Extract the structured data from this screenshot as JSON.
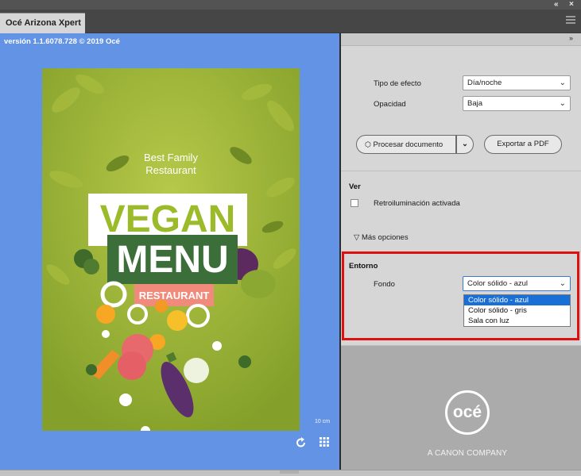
{
  "window": {
    "title_tab": "Océ Arizona Xpert",
    "top_controls": [
      "«",
      "×"
    ],
    "right_collapse": "»"
  },
  "preview": {
    "version_text": "versión 1.1.6078.728 © 2019 Océ",
    "poster_text": {
      "line1": "Best Family",
      "line2": "Restaurant",
      "vegan": "VEGAN",
      "menu": "MENU",
      "restaurant": "RESTAURANT"
    },
    "scale_label": "10 cm"
  },
  "settings": {
    "tipo_label": "Tipo de efecto",
    "tipo_value": "Día/noche",
    "opacidad_label": "Opacidad",
    "opacidad_value": "Baja",
    "procesar_label": "Procesar documento",
    "exportar_label": "Exportar a PDF"
  },
  "ver": {
    "title": "Ver",
    "retro_label": "Retroiluminación activada",
    "mas_opciones": "Más opciones"
  },
  "entorno": {
    "title": "Entorno",
    "fondo_label": "Fondo",
    "fondo_value": "Color sólido - azul",
    "options": [
      "Color sólido - azul",
      "Color sólido - gris",
      "Sala con luz"
    ]
  },
  "brand": {
    "logo_text": "océ",
    "tagline": "A CANON COMPANY"
  },
  "colors": {
    "preview_bg": "#6393e4",
    "accent_red": "#e11010",
    "selected_option": "#1a6fd6"
  }
}
